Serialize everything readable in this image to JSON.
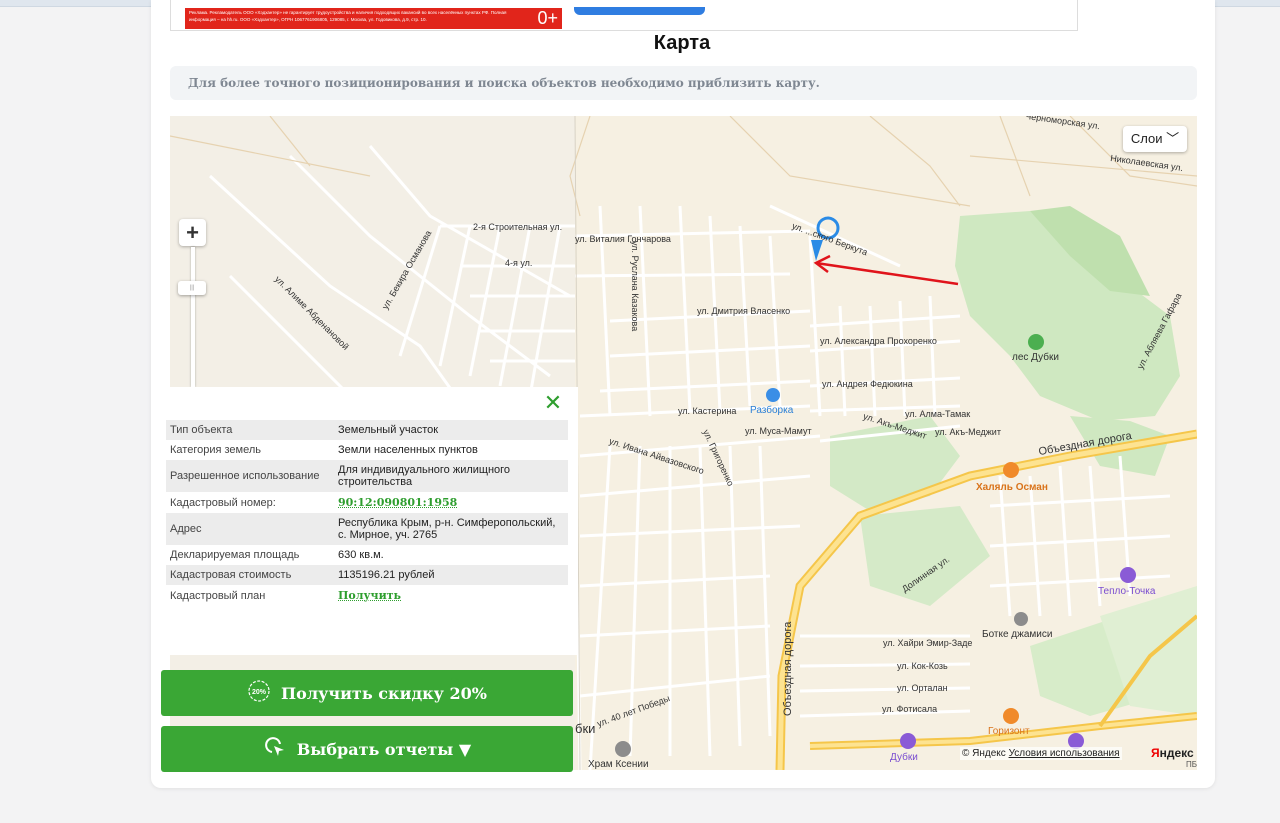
{
  "ad": {
    "text": "Реклама. Рекламодатель ООО «Хэдхантер» не гарантирует трудоустройства и наличия подходящих вакансий во всех населённых пунктах РФ. Полная информация – на hh.ru. ООО «Хэдхантер», ОГРН 1067761906805, 129085, г. Москва, ул. Годовикова, д.9, стр. 10.",
    "badge": "0+"
  },
  "page": {
    "title": "Карта",
    "notice": "Для более точного позиционирования и поиска объектов необходимо приблизить карту."
  },
  "map": {
    "layers_label": "Слои",
    "zoom_plus": "+",
    "streets": {
      "chernomorskaya": "Черноморская ул.",
      "nikolaevskaya": "Николаевская ул.",
      "stroitelnaya2": "2-я Строительная ул.",
      "ul4": "4-я ул.",
      "vitalia": "ул. Виталия Гончарова",
      "berkuta": "ул. ...ского Беркута",
      "ruslana": "ул. Руслана Казакова",
      "bekira": "ул. Бекира Османова",
      "alime": "ул. Алиме Абденановой",
      "dmitria": "ул. Дмитрия Власенко",
      "aleksandra": "ул. Александра Прохоренко",
      "andreya": "ул. Андрея Федюкина",
      "kasterina": "ул. Кастерина",
      "musa": "ул. Муса-Мамут",
      "alma": "ул. Алма-Тамак",
      "akmedzhit1": "ул. Акъ-Меджит",
      "akmedzhit2": "ул. Акъ-Меджит",
      "obezdnaya": "Объездная дорога",
      "obezdnaya2": "Объездная дорога",
      "aivazovskogo": "ул. Ивана Айвазовского",
      "grigorenko": "ул. Григоренко",
      "hairi": "ул. Хайри Эмир-Заде",
      "kokkoz": "ул. Кок-Козь",
      "ortalan": "ул. Орталан",
      "fotisala": "ул. Фотисала",
      "dolinnaya": "Долинная ул.",
      "pobedy": "ул. 40 лет Победы",
      "ablaeva": "ул. Абляева Гафара"
    },
    "pois": {
      "les_dubki": "лес Дубки",
      "razborka": "Разборка",
      "halyal": "Халяль Осман",
      "teplo": "Тепло-Точка",
      "botke": "Ботке джамиси",
      "gorizont": "Горизонт",
      "dubki": "Дубки",
      "hram": "Храм Ксении",
      "bki": "бки"
    },
    "copyright": "© Яндекс",
    "terms": "Условия использования",
    "yandex_a": "Я",
    "yandex_b": "ндекс",
    "pb": "ПБ"
  },
  "info": {
    "rows": [
      {
        "k": "Тип объекта",
        "v": "Земельный участок"
      },
      {
        "k": "Категория земель",
        "v": "Земли населенных пунктов"
      },
      {
        "k": "Разрешенное использование",
        "v": "Для индивидуального жилищного строительства"
      },
      {
        "k": "Кадастровый номер:",
        "v": "90:12:090801:1958"
      },
      {
        "k": "Адрес",
        "v": "Республика Крым, р-н. Симферопольский, с. Мирное, уч. 2765"
      },
      {
        "k": "Декларируемая площадь",
        "v": "630 кв.м."
      },
      {
        "k": "Кадастровая стоимость",
        "v": "1135196.21 рублей"
      },
      {
        "k": "Кадастровый план",
        "v": "Получить"
      }
    ]
  },
  "buttons": {
    "discount_badge": "20%",
    "discount": "Получить скидку 20%",
    "reports": "Выбрать отчеты ▼"
  },
  "colors": {
    "green": "#3aa735",
    "marker": "#2a8be6",
    "arrow": "#e0141b"
  }
}
